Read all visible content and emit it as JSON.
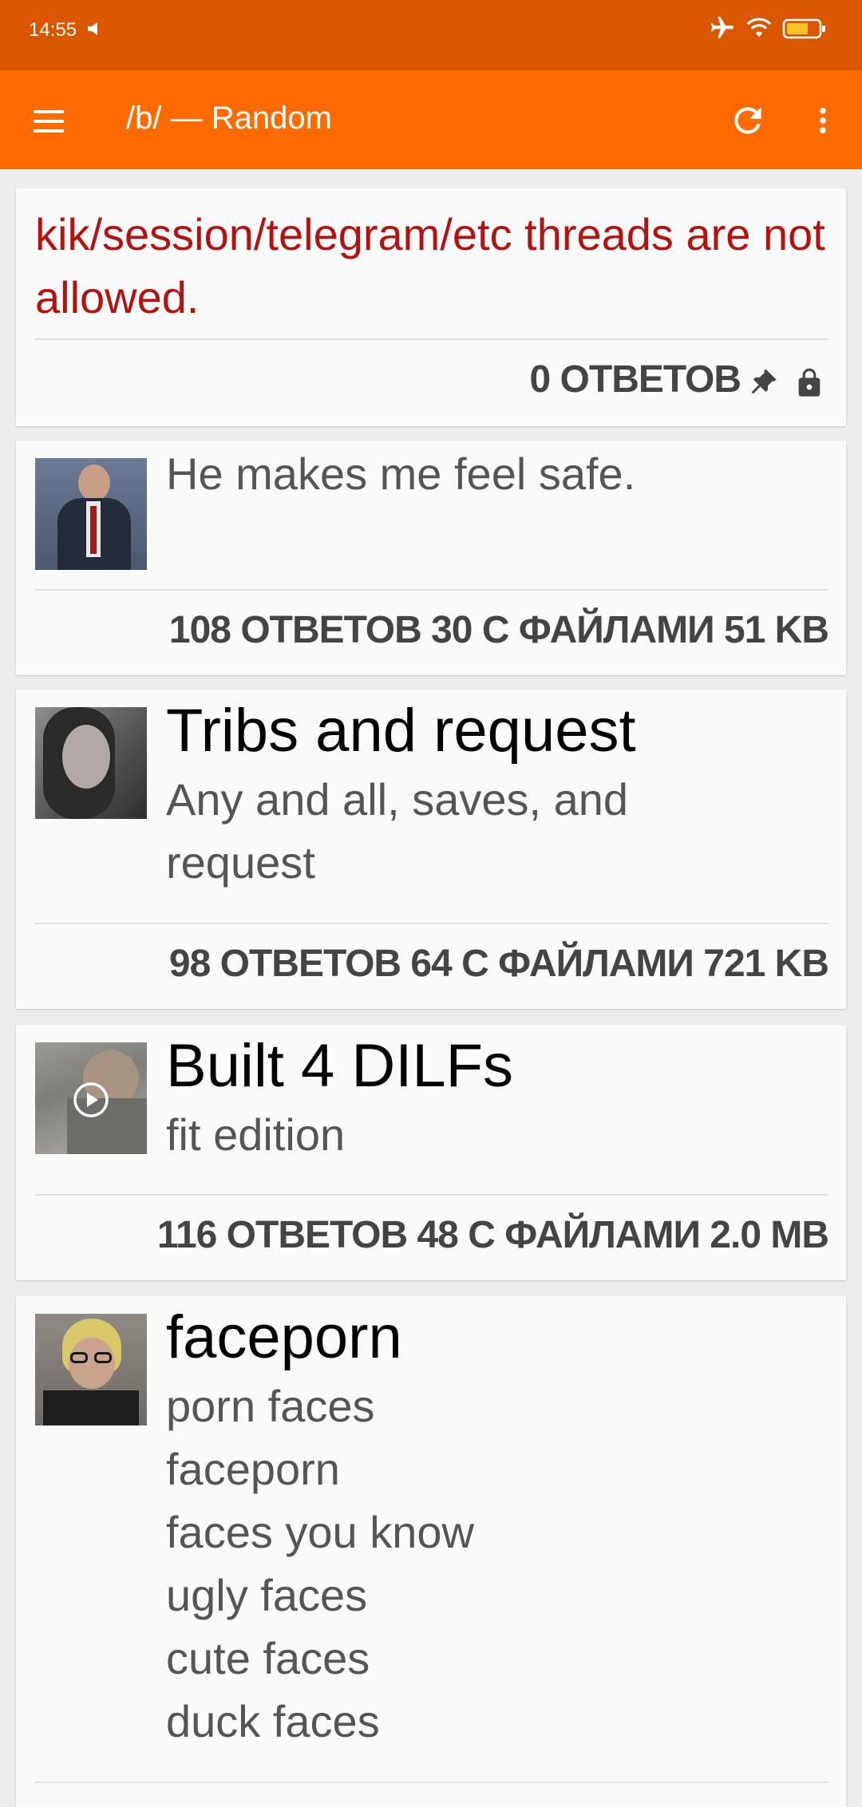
{
  "status_bar": {
    "time": "14:55",
    "icons": [
      "sound-icon",
      "airplane-icon",
      "wifi-icon",
      "battery-icon"
    ]
  },
  "toolbar": {
    "title": "/b/ — Random",
    "icons": [
      "menu-icon",
      "refresh-icon",
      "more-vert-icon"
    ],
    "color": "#ff6b00"
  },
  "threads": [
    {
      "comment": "kik/session/telegram/etc threads are not allowed.",
      "stats": "0 ОТВЕТОВ",
      "sticky": true,
      "closed": true
    },
    {
      "comment": "He makes me feel safe.",
      "stats": "108 ОТВЕТОВ 30 С ФАЙЛАМИ 51 KB"
    },
    {
      "subject": "Tribs and request",
      "comment": "Any and all, saves, and\nrequest",
      "stats": "98 ОТВЕТОВ 64 С ФАЙЛАМИ 721 KB"
    },
    {
      "subject": "Built 4 DILFs",
      "comment": "fit edition",
      "stats": "116 ОТВЕТОВ 48 С ФАЙЛАМИ 2.0 MB",
      "video": true
    },
    {
      "subject": "faceporn",
      "comment": "porn faces\nfaceporn\nfaces you know\nugly faces\ncute faces\nduck faces"
    }
  ]
}
